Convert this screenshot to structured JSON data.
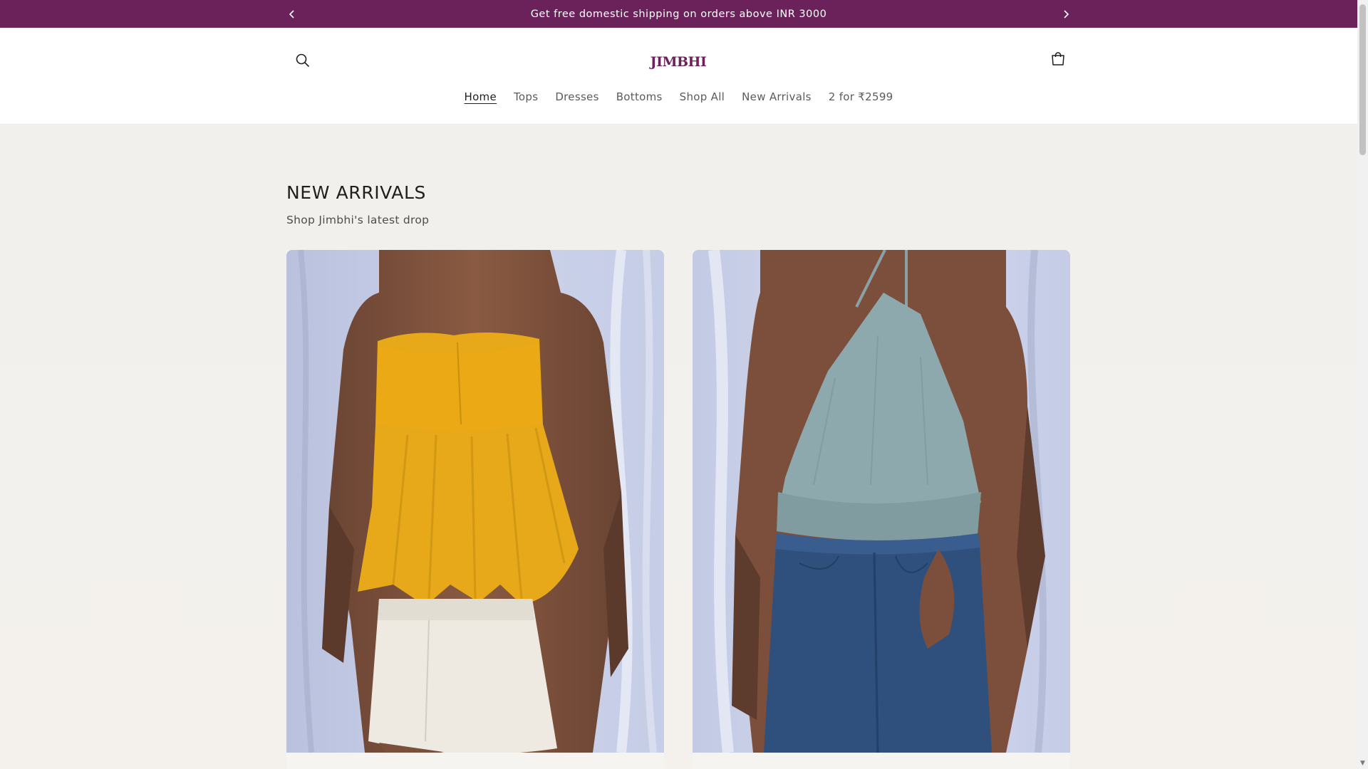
{
  "announcement": {
    "text": "Get free domestic shipping on orders above INR 3000",
    "prev_icon": "chevron-left-icon",
    "next_icon": "chevron-right-icon"
  },
  "header": {
    "logo": "JIMBHI",
    "search_icon": "search-icon",
    "cart_icon": "cart-icon",
    "nav": [
      {
        "label": "Home",
        "active": true
      },
      {
        "label": "Tops"
      },
      {
        "label": "Dresses"
      },
      {
        "label": "Bottoms"
      },
      {
        "label": "Shop All"
      },
      {
        "label": "New Arrivals"
      },
      {
        "label": "2 for ₹2599"
      }
    ]
  },
  "section": {
    "title": "NEW ARRIVALS",
    "subtitle": "Shop Jimbhi's latest drop"
  },
  "colors": {
    "brand": "#6b2159",
    "page_bg": "#f3f2ee"
  }
}
